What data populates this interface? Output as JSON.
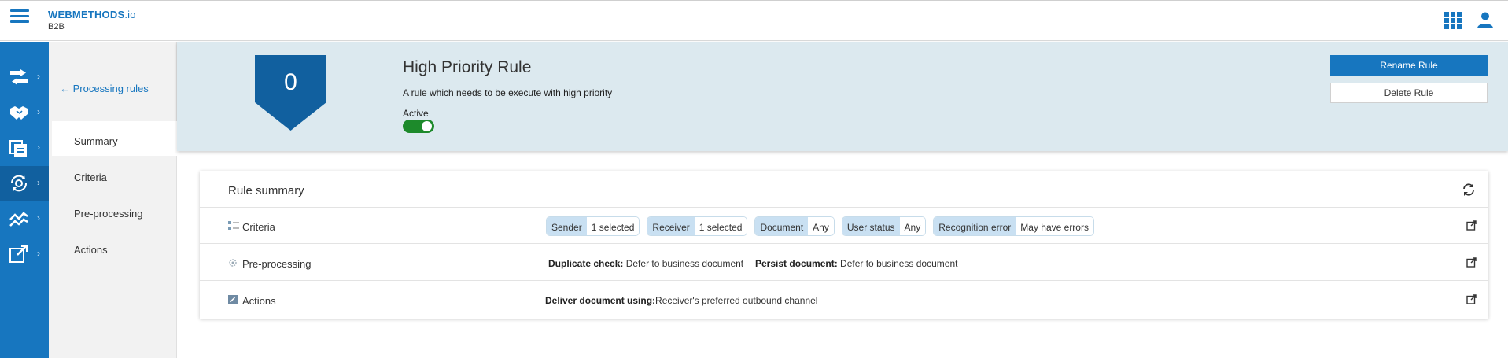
{
  "app": {
    "brand_name": "WEBMETHODS",
    "brand_suffix": ".io",
    "product": "B2B"
  },
  "icons": {
    "menu": "hamburger-icon",
    "apps": "apps-grid-icon",
    "user": "user-icon",
    "refresh": "refresh-icon",
    "open": "external-link-icon"
  },
  "rail": {
    "items": [
      {
        "name": "transfer",
        "icon": "transfer-arrows-icon"
      },
      {
        "name": "partners",
        "icon": "handshake-icon"
      },
      {
        "name": "documents",
        "icon": "documents-icon"
      },
      {
        "name": "processing-rules",
        "icon": "gear-arrows-icon",
        "active": true
      },
      {
        "name": "monitoring",
        "icon": "chart-line-icon"
      },
      {
        "name": "admin",
        "icon": "external-edit-icon"
      }
    ]
  },
  "subnav": {
    "back_label": "Processing rules",
    "items": [
      "Summary",
      "Criteria",
      "Pre-processing",
      "Actions"
    ],
    "active": "Summary"
  },
  "rule": {
    "priority": "0",
    "title": "High Priority Rule",
    "description": "A rule which needs to be execute with high priority",
    "status_label": "Active",
    "active": true,
    "rename_label": "Rename Rule",
    "delete_label": "Delete Rule"
  },
  "summary": {
    "title": "Rule summary",
    "criteria": {
      "label": "Criteria",
      "chips": [
        {
          "key": "Sender",
          "value": "1 selected"
        },
        {
          "key": "Receiver",
          "value": "1 selected"
        },
        {
          "key": "Document",
          "value": "Any"
        },
        {
          "key": "User status",
          "value": "Any"
        },
        {
          "key": "Recognition error",
          "value": "May have errors"
        }
      ]
    },
    "preprocessing": {
      "label": "Pre-processing",
      "duplicate_key": "Duplicate check:",
      "duplicate_value": "Defer to business document",
      "persist_key": "Persist document:",
      "persist_value": "Defer to business document"
    },
    "actions": {
      "label": "Actions",
      "deliver_key": "Deliver document using:",
      "deliver_value": "Receiver's preferred outbound channel"
    }
  },
  "colors": {
    "brand": "#1776bf",
    "rail_active": "#11609f",
    "header_bg": "#dce9ef",
    "badge": "#11609f",
    "toggle_on": "#1d8a2b",
    "chip_key": "#c9e0f2"
  }
}
